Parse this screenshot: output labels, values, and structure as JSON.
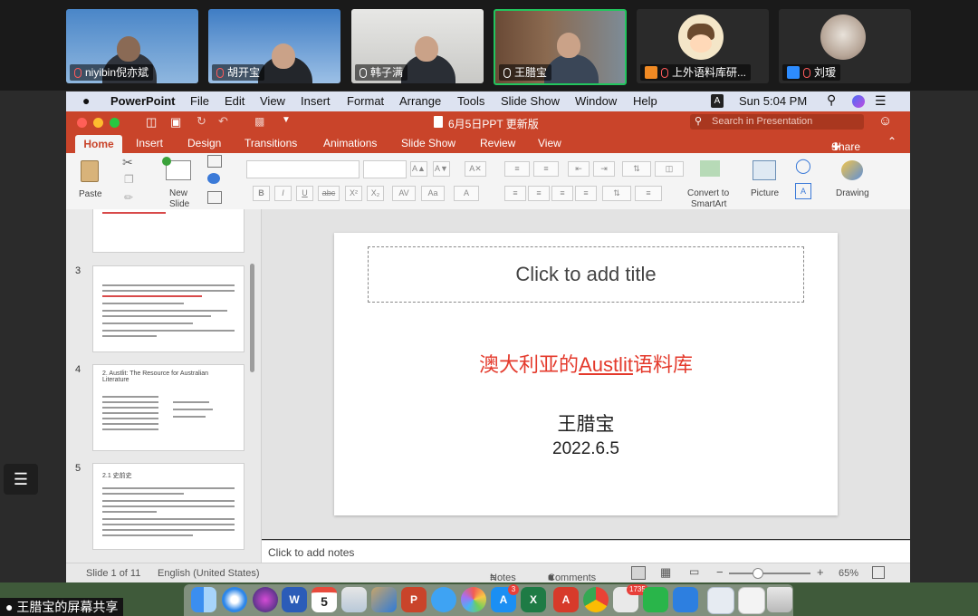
{
  "participants": [
    {
      "name": "niyibin倪亦斌",
      "muted": true
    },
    {
      "name": "胡开宝",
      "muted": true
    },
    {
      "name": "韩子满",
      "muted": false
    },
    {
      "name": "王腊宝",
      "muted": false,
      "active_speaker": true
    },
    {
      "name": "上外语料库研...",
      "muted": true
    },
    {
      "name": "刘瑷",
      "muted": true
    }
  ],
  "menubar": {
    "app": "PowerPoint",
    "items": [
      "File",
      "Edit",
      "View",
      "Insert",
      "Format",
      "Arrange",
      "Tools",
      "Slide Show",
      "Window",
      "Help"
    ],
    "input_badge": "A",
    "clock": "Sun 5:04 PM"
  },
  "ppt": {
    "doc_title": "6月5日PPT 更新版",
    "search_placeholder": "Search in Presentation",
    "tabs": [
      "Home",
      "Insert",
      "Design",
      "Transitions",
      "Animations",
      "Slide Show",
      "Review",
      "View"
    ],
    "share_label": "Share",
    "ribbon": {
      "paste": "Paste",
      "new_slide_1": "New",
      "new_slide_2": "Slide",
      "bold": "B",
      "italic": "I",
      "underline": "U",
      "strike": "abc",
      "superscript": "X²",
      "subscript": "X₂",
      "convert_1": "Convert to",
      "convert_2": "SmartArt",
      "picture": "Picture",
      "drawing": "Drawing"
    }
  },
  "thumbnails": [
    {
      "num": "3"
    },
    {
      "num": "4",
      "title": "2. Austlit: The Resource for Australian Literature"
    },
    {
      "num": "5",
      "title": "2.1 史前史"
    }
  ],
  "slide": {
    "title_placeholder": "Click to add title",
    "subtitle_pre": "澳大利亚的",
    "subtitle_link": "Austlit",
    "subtitle_post": "语料库",
    "author": "王腊宝",
    "date": "2022.6.5"
  },
  "notes_placeholder": "Click to add notes",
  "status": {
    "slide": "Slide 1 of 11",
    "language": "English (United States)",
    "notes": "Notes",
    "comments": "Comments",
    "zoom": "65%"
  },
  "dock": {
    "calendar_day": "5",
    "mail_badge": "1735",
    "appstore_badge": "3"
  },
  "screen_share_label": "王腊宝的屏幕共享",
  "colors": {
    "ppt_accent": "#c9442a",
    "subtitle_red": "#e43a2c",
    "active_speaker": "#22c55e"
  }
}
